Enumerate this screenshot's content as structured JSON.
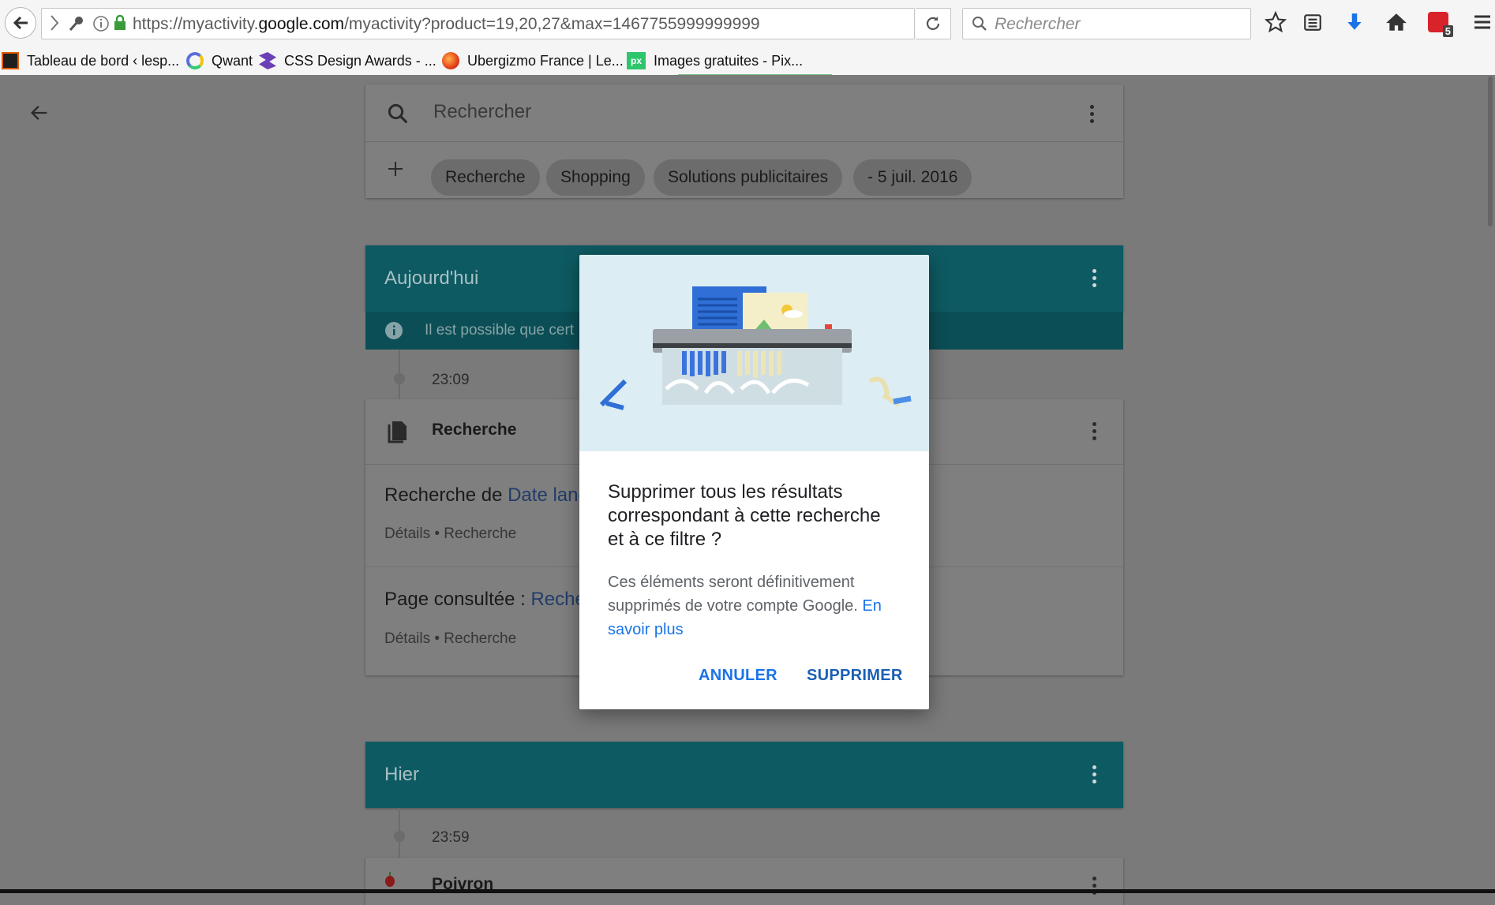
{
  "browser": {
    "url_prefix": "https://myactivity.",
    "url_domain": "google.com",
    "url_suffix": "/myactivity?product=19,20,27&max=1467755999999999",
    "search_placeholder": "Rechercher",
    "addon_badge": "5",
    "bookmarks": [
      {
        "label": "Tableau de bord ‹ lesp...",
        "icon": "wordpress-icon"
      },
      {
        "label": "Qwant",
        "icon": "qwant-icon"
      },
      {
        "label": "CSS Design Awards - ...",
        "icon": "cssda-icon"
      },
      {
        "label": "Ubergizmo France | Le...",
        "icon": "ubergizmo-icon"
      },
      {
        "label": "Images gratuites - Pix...",
        "icon": "pixabay-icon"
      }
    ]
  },
  "page": {
    "search_placeholder": "Rechercher",
    "filters": [
      "Recherche",
      "Shopping",
      "Solutions publicitaires",
      "- 5 juil. 2016"
    ],
    "today": {
      "title": "Aujourd'hui",
      "info": "Il est possible que cert",
      "time": "23:09",
      "card_title": "Recherche",
      "entry1_prefix": "Recherche de ",
      "entry1_link": "Date lanc",
      "entry1_meta": "Détails • Recherche",
      "entry2_prefix": "Page consultée : ",
      "entry2_link": "Reche",
      "entry2_meta": "Détails • Recherche"
    },
    "yesterday": {
      "title": "Hier",
      "time": "23:59",
      "card_title": "Poivron"
    }
  },
  "dialog": {
    "title": "Supprimer tous les résultats correspondant à cette recherche et à ce filtre ?",
    "body": "Ces éléments seront définitivement supprimés de votre compte Google. ",
    "link": "En savoir plus",
    "cancel": "ANNULER",
    "delete": "SUPPRIMER"
  },
  "colors": {
    "section_header": "#0e5a62",
    "dialog_accent": "#1a73e8",
    "highlight": "#f4f60a"
  }
}
